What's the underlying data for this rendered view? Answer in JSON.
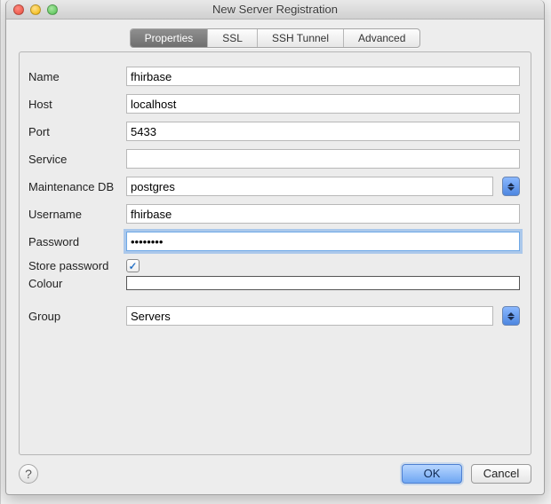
{
  "window": {
    "title": "New Server Registration"
  },
  "tabs": {
    "properties": "Properties",
    "ssl": "SSL",
    "ssh_tunnel": "SSH Tunnel",
    "advanced": "Advanced"
  },
  "labels": {
    "name": "Name",
    "host": "Host",
    "port": "Port",
    "service": "Service",
    "maintenance_db": "Maintenance DB",
    "username": "Username",
    "password": "Password",
    "store_password": "Store password",
    "colour": "Colour",
    "group": "Group"
  },
  "values": {
    "name": "fhirbase",
    "host": "localhost",
    "port": "5433",
    "service": "",
    "maintenance_db": "postgres",
    "username": "fhirbase",
    "password": "••••••••",
    "store_password_checked": true,
    "group": "Servers"
  },
  "buttons": {
    "ok": "OK",
    "cancel": "Cancel",
    "help": "?"
  }
}
